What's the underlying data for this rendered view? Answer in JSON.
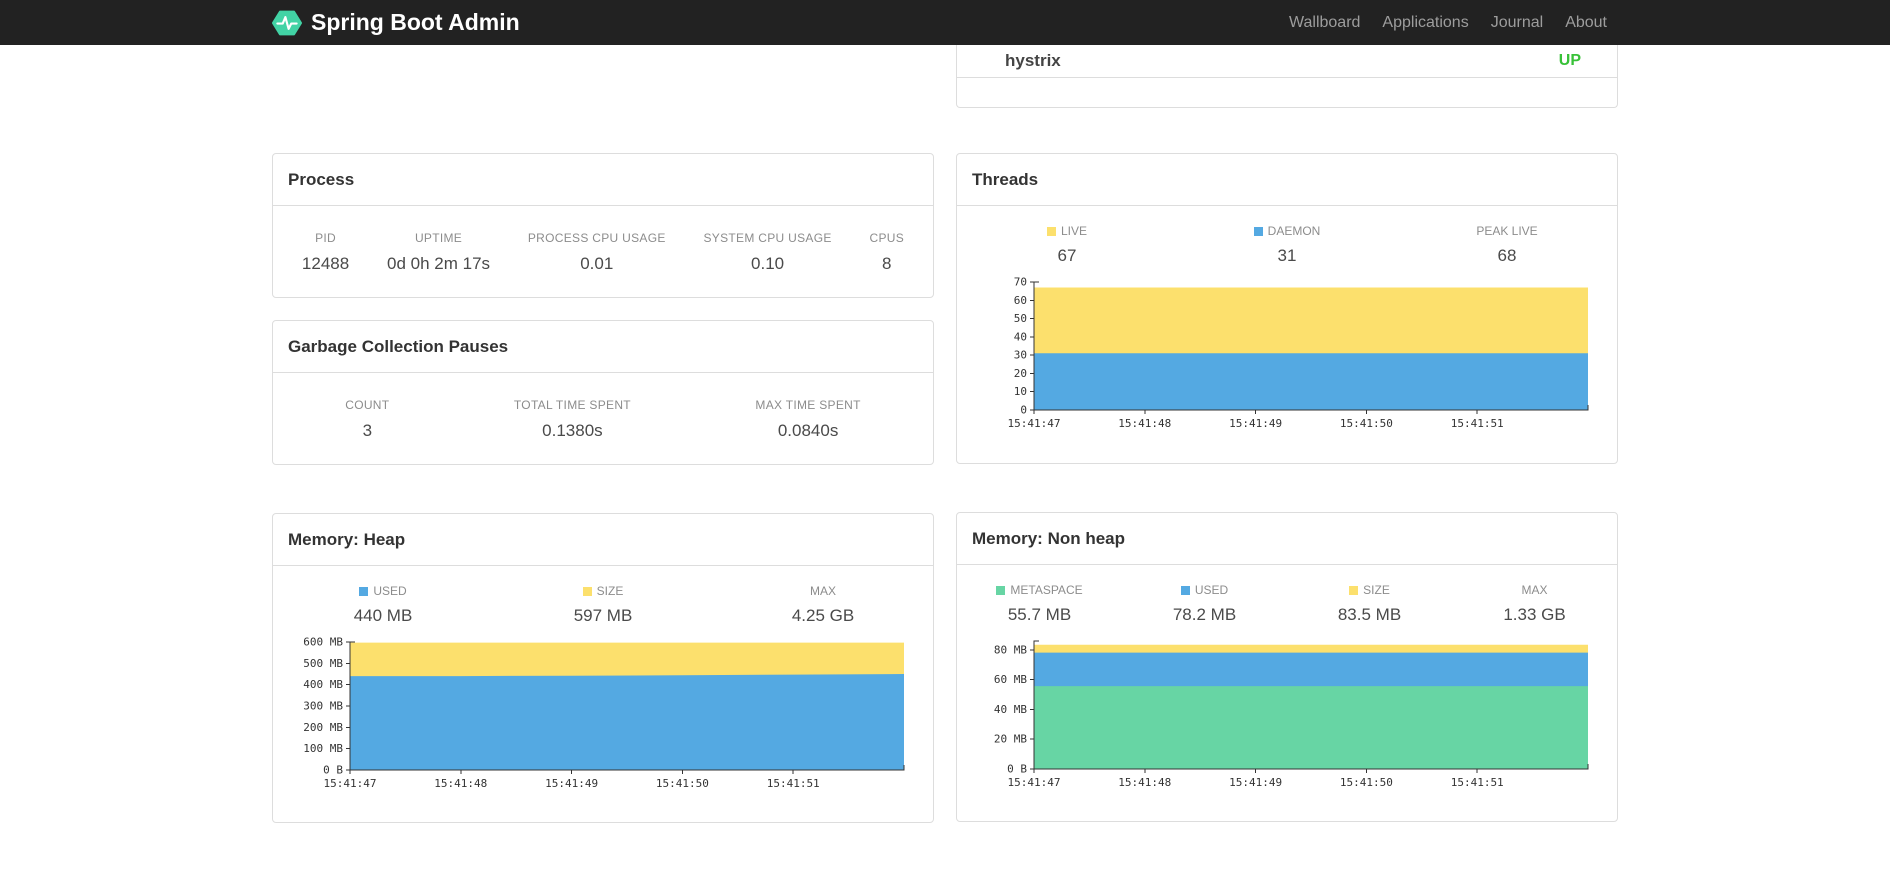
{
  "navbar": {
    "brand": "Spring Boot Admin",
    "links": [
      {
        "label": "Wallboard"
      },
      {
        "label": "Applications"
      },
      {
        "label": "Journal"
      },
      {
        "label": "About"
      }
    ]
  },
  "colors": {
    "accent_green": "#42d3a5",
    "status_up": "#38c138",
    "series_yellow": "#fce06d",
    "series_blue": "#54a9e2",
    "series_green": "#67d5a4"
  },
  "health_card": {
    "rows": [
      {
        "name": "hystrix",
        "status": "UP",
        "status_color": "#38c138"
      }
    ]
  },
  "process_card": {
    "title": "Process",
    "stats": [
      {
        "label": "PID",
        "value": "12488"
      },
      {
        "label": "UPTIME",
        "value": "0d 0h 2m 17s"
      },
      {
        "label": "PROCESS CPU USAGE",
        "value": "0.01"
      },
      {
        "label": "SYSTEM CPU USAGE",
        "value": "0.10"
      },
      {
        "label": "CPUS",
        "value": "8"
      }
    ]
  },
  "gc_card": {
    "title": "Garbage Collection Pauses",
    "stats": [
      {
        "label": "COUNT",
        "value": "3"
      },
      {
        "label": "TOTAL TIME SPENT",
        "value": "0.1380s"
      },
      {
        "label": "MAX TIME SPENT",
        "value": "0.0840s"
      }
    ]
  },
  "threads_card": {
    "title": "Threads",
    "legend": [
      {
        "label": "LIVE",
        "value": "67",
        "color": "#fce06d"
      },
      {
        "label": "DAEMON",
        "value": "31",
        "color": "#54a9e2"
      },
      {
        "label": "PEAK LIVE",
        "value": "68"
      }
    ]
  },
  "heap_card": {
    "title": "Memory: Heap",
    "legend": [
      {
        "label": "USED",
        "value": "440 MB",
        "color": "#54a9e2"
      },
      {
        "label": "SIZE",
        "value": "597 MB",
        "color": "#fce06d"
      },
      {
        "label": "MAX",
        "value": "4.25 GB"
      }
    ]
  },
  "nonheap_card": {
    "title": "Memory: Non heap",
    "legend": [
      {
        "label": "METASPACE",
        "value": "55.7 MB",
        "color": "#67d5a4"
      },
      {
        "label": "USED",
        "value": "78.2 MB",
        "color": "#54a9e2"
      },
      {
        "label": "SIZE",
        "value": "83.5 MB",
        "color": "#fce06d"
      },
      {
        "label": "MAX",
        "value": "1.33 GB"
      }
    ]
  },
  "chart_data": [
    {
      "id": "threads",
      "type": "area",
      "title": "Threads",
      "x": [
        "15:41:47",
        "15:41:48",
        "15:41:49",
        "15:41:50",
        "15:41:51",
        ""
      ],
      "series": [
        {
          "name": "live",
          "color": "#fce06d",
          "values": [
            67,
            67,
            67,
            67,
            67,
            67
          ]
        },
        {
          "name": "daemon",
          "color": "#54a9e2",
          "values": [
            31,
            31,
            31,
            31,
            31,
            31
          ]
        }
      ],
      "ylim": [
        0,
        70
      ],
      "yticks": [
        {
          "v": 0,
          "label": "0"
        },
        {
          "v": 10,
          "label": "10"
        },
        {
          "v": 20,
          "label": "20"
        },
        {
          "v": 30,
          "label": "30"
        },
        {
          "v": 40,
          "label": "40"
        },
        {
          "v": 50,
          "label": "50"
        },
        {
          "v": 60,
          "label": "60"
        },
        {
          "v": 70,
          "label": "70"
        }
      ],
      "legend_position": "top",
      "grid": false
    },
    {
      "id": "heap",
      "type": "area",
      "title": "Memory: Heap",
      "x": [
        "15:41:47",
        "15:41:48",
        "15:41:49",
        "15:41:50",
        "15:41:51",
        ""
      ],
      "series": [
        {
          "name": "size",
          "color": "#fce06d",
          "values": [
            597,
            597,
            597,
            597,
            597,
            597
          ]
        },
        {
          "name": "used",
          "color": "#54a9e2",
          "values": [
            440,
            440,
            442,
            444,
            447,
            450
          ]
        }
      ],
      "ylim": [
        0,
        600
      ],
      "yticks": [
        {
          "v": 0,
          "label": "0 B"
        },
        {
          "v": 100,
          "label": "100 MB"
        },
        {
          "v": 200,
          "label": "200 MB"
        },
        {
          "v": 300,
          "label": "300 MB"
        },
        {
          "v": 400,
          "label": "400 MB"
        },
        {
          "v": 500,
          "label": "500 MB"
        },
        {
          "v": 600,
          "label": "600 MB"
        }
      ],
      "legend_position": "top",
      "grid": false
    },
    {
      "id": "nonheap",
      "type": "area",
      "title": "Memory: Non heap",
      "x": [
        "15:41:47",
        "15:41:48",
        "15:41:49",
        "15:41:50",
        "15:41:51",
        ""
      ],
      "series": [
        {
          "name": "size",
          "color": "#fce06d",
          "values": [
            83.5,
            83.5,
            83.5,
            83.5,
            83.5,
            83.5
          ]
        },
        {
          "name": "used",
          "color": "#54a9e2",
          "values": [
            78.2,
            78.2,
            78.2,
            78.2,
            78.2,
            78.2
          ]
        },
        {
          "name": "metaspace",
          "color": "#67d5a4",
          "values": [
            55.7,
            55.7,
            55.7,
            55.7,
            55.7,
            55.7
          ]
        }
      ],
      "ylim": [
        0,
        86
      ],
      "yticks": [
        {
          "v": 0,
          "label": "0 B"
        },
        {
          "v": 20,
          "label": "20 MB"
        },
        {
          "v": 40,
          "label": "40 MB"
        },
        {
          "v": 60,
          "label": "60 MB"
        },
        {
          "v": 80,
          "label": "80 MB"
        }
      ],
      "legend_position": "top",
      "grid": false
    }
  ]
}
